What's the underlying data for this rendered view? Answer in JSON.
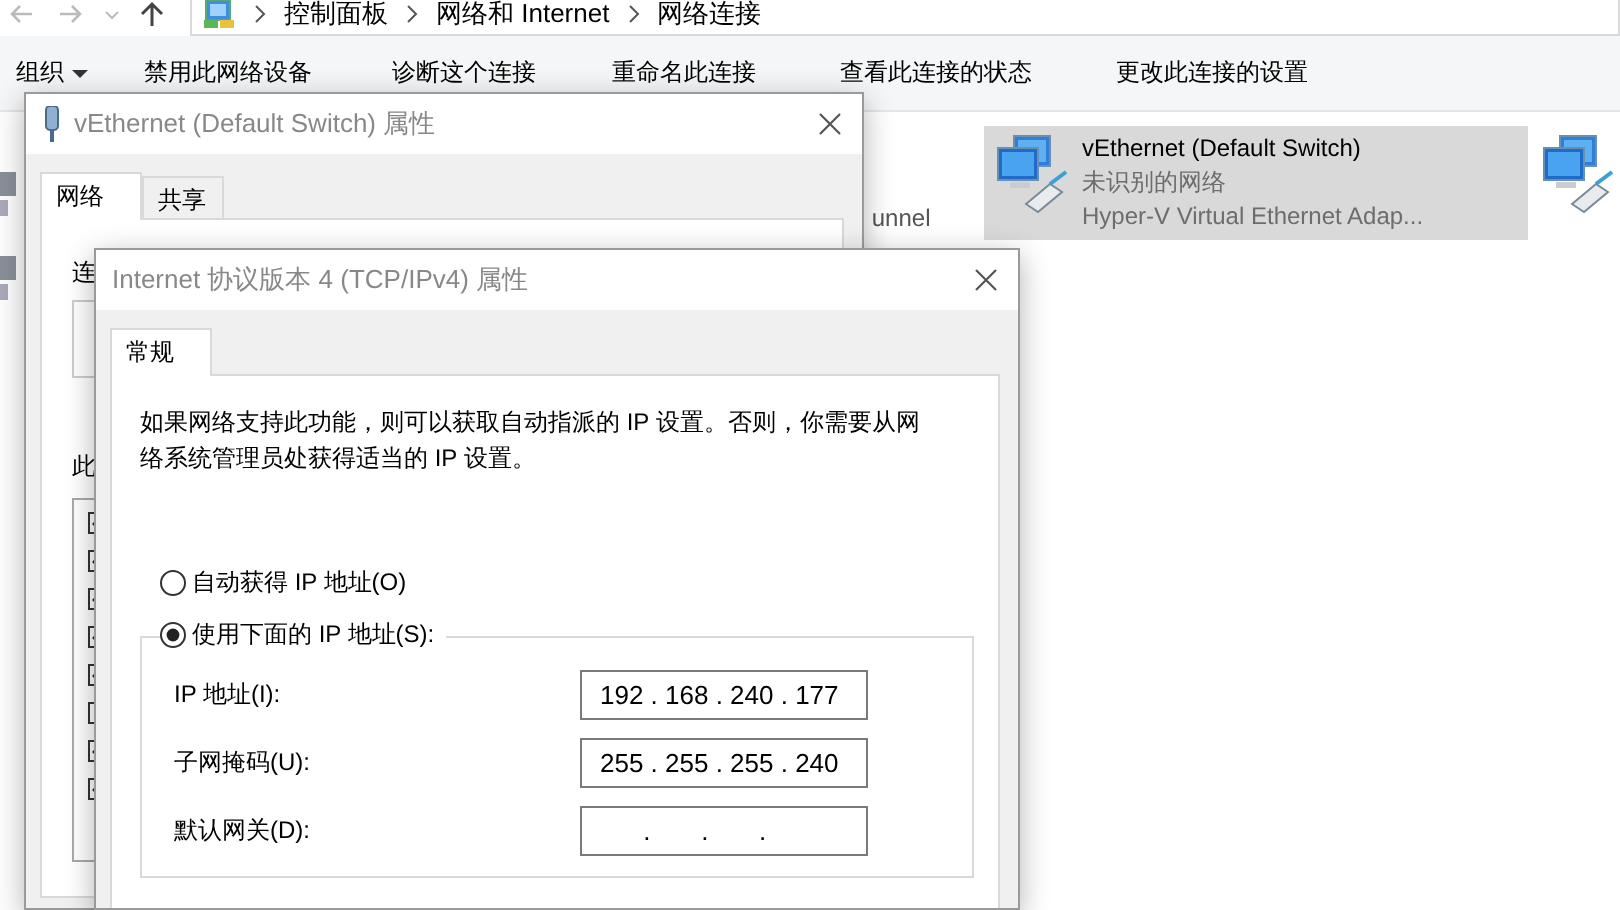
{
  "explorer": {
    "breadcrumbs": [
      "控制面板",
      "网络和 Internet",
      "网络连接"
    ],
    "toolbar": [
      {
        "label": "组织",
        "dropdown": true
      },
      {
        "label": "禁用此网络设备",
        "dropdown": false
      },
      {
        "label": "诊断这个连接",
        "dropdown": false
      },
      {
        "label": "重命名此连接",
        "dropdown": false
      },
      {
        "label": "查看此连接的状态",
        "dropdown": false
      },
      {
        "label": "更改此连接的设置",
        "dropdown": false
      }
    ],
    "partial_item_text": "unnel",
    "connections": [
      {
        "name": "vEthernet (Default Switch)",
        "status": "未识别的网络",
        "adapter": "Hyper-V Virtual Ethernet Adap...",
        "selected": true
      }
    ]
  },
  "adapter_dialog": {
    "title": "vEthernet (Default Switch) 属性",
    "tabs": [
      {
        "label": "网络",
        "selected": true
      },
      {
        "label": "共享",
        "selected": false
      }
    ],
    "label_1": "连",
    "label_2": "此",
    "components": [
      {
        "checked": true
      },
      {
        "checked": true
      },
      {
        "checked": true
      },
      {
        "checked": true
      },
      {
        "checked": true
      },
      {
        "checked": false
      },
      {
        "checked": true
      },
      {
        "checked": true
      }
    ]
  },
  "ipv4_dialog": {
    "title": "Internet 协议版本 4 (TCP/IPv4) 属性",
    "tabs": [
      {
        "label": "常规",
        "selected": true
      }
    ],
    "description": "如果网络支持此功能，则可以获取自动指派的 IP 设置。否则，你需要从网络系统管理员处获得适当的 IP 设置。",
    "radios": [
      {
        "label": "自动获得 IP 地址(O)",
        "selected": false
      },
      {
        "label": "使用下面的 IP 地址(S):",
        "selected": true
      }
    ],
    "fields": [
      {
        "label": "IP 地址(I):",
        "value": "192 . 168 . 240 . 177"
      },
      {
        "label": "子网掩码(U):",
        "value": "255 . 255 . 255 . 240"
      },
      {
        "label": "默认网关(D):",
        "value": "      .       .       ."
      }
    ]
  }
}
